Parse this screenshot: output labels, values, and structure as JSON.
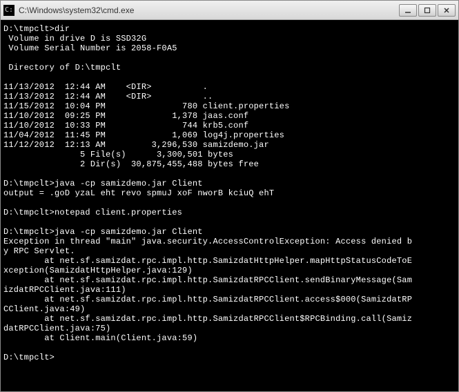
{
  "window": {
    "title": "C:\\Windows\\system32\\cmd.exe"
  },
  "terminal": {
    "prompt1": "D:\\tmpclt>dir",
    "vol1": " Volume in drive D is SSD32G",
    "vol2": " Volume Serial Number is 2058-F0A5",
    "blank": "",
    "dirof": " Directory of D:\\tmpclt",
    "l1": "11/13/2012  12:44 AM    <DIR>          .",
    "l2": "11/13/2012  12:44 AM    <DIR>          ..",
    "l3": "11/15/2012  10:04 PM               780 client.properties",
    "l4": "11/10/2012  09:25 PM             1,378 jaas.conf",
    "l5": "11/10/2012  10:33 PM               744 krb5.conf",
    "l6": "11/04/2012  11:45 PM             1,069 log4j.properties",
    "l7": "11/12/2012  12:13 AM         3,296,530 samizdemo.jar",
    "sum1": "               5 File(s)      3,300,501 bytes",
    "sum2": "               2 Dir(s)  30,875,455,488 bytes free",
    "cmd1": "D:\\tmpclt>java -cp samizdemo.jar Client",
    "out1": "output = .goD yzaL eht revo spmuJ xoF nworB kciuQ ehT",
    "cmd2": "D:\\tmpclt>notepad client.properties",
    "cmd3": "D:\\tmpclt>java -cp samizdemo.jar Client",
    "exc1": "Exception in thread \"main\" java.security.AccessControlException: Access denied b\ny RPC Servlet.",
    "exc2": "        at net.sf.samizdat.rpc.impl.http.SamizdatHttpHelper.mapHttpStatusCodeToE\nxception(SamizdatHttpHelper.java:129)",
    "exc3": "        at net.sf.samizdat.rpc.impl.http.SamizdatRPCClient.sendBinaryMessage(Sam\nizdatRPCClient.java:111)",
    "exc4": "        at net.sf.samizdat.rpc.impl.http.SamizdatRPCClient.access$000(SamizdatRP\nCClient.java:49)",
    "exc5": "        at net.sf.samizdat.rpc.impl.http.SamizdatRPCClient$RPCBinding.call(Samiz\ndatRPCClient.java:75)",
    "exc6": "        at Client.main(Client.java:59)",
    "prompt2": "D:\\tmpclt>"
  }
}
